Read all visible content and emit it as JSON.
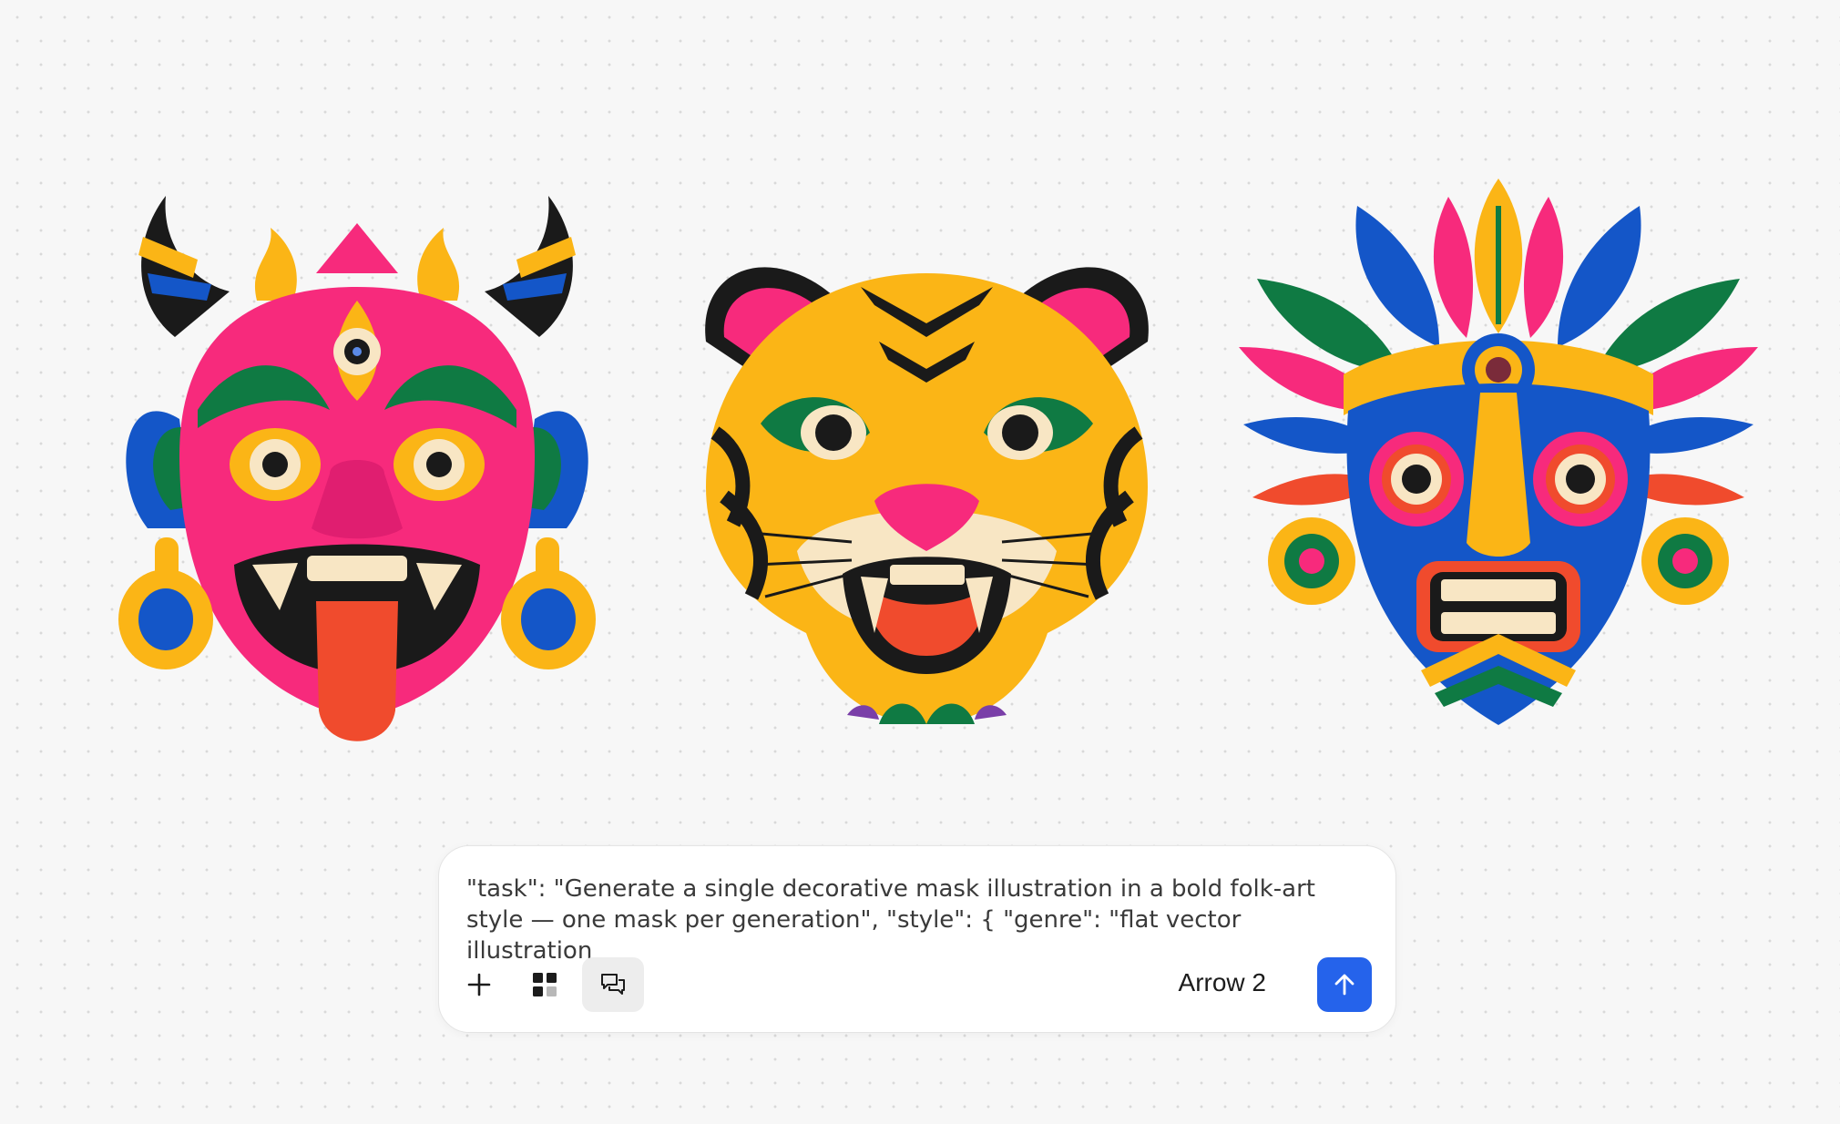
{
  "gallery": {
    "masks": [
      {
        "subject": "demon mask",
        "icon": "demon-mask-icon"
      },
      {
        "subject": "tiger mask",
        "icon": "tiger-mask-icon"
      },
      {
        "subject": "tribal feathered mask",
        "icon": "tribal-mask-icon"
      }
    ]
  },
  "prompt": {
    "text": "\"task\": \"Generate a single decorative mask illustration in a bold folk-art\nstyle — one mask per generation\", \"style\": { \"genre\": \"flat vector illustration"
  },
  "toolbar": {
    "add_icon": "plus-icon",
    "grid_icon": "grid-icon",
    "chat_icon": "chat-icon",
    "model_label": "Arrow 2",
    "send_icon": "arrow-up-icon"
  },
  "colors": {
    "send_button": "#2563eb",
    "pink": "#f72a7c",
    "yellow": "#fbb516",
    "blue": "#1456c8",
    "green": "#0f7a43",
    "red": "#f04b2d"
  }
}
